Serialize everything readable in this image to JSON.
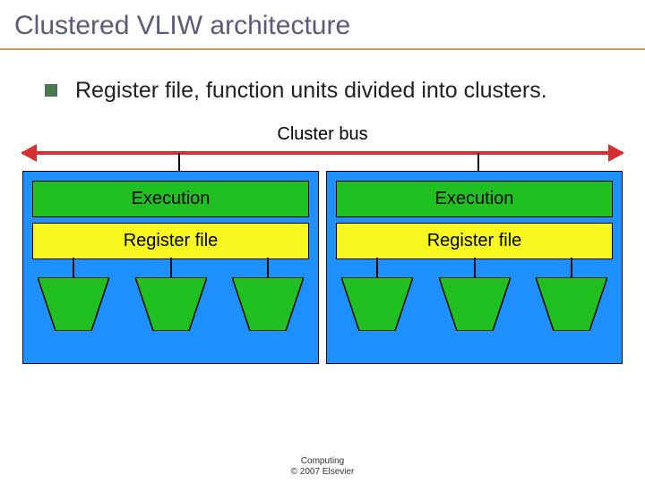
{
  "title": "Clustered VLIW architecture",
  "bullet": "Register file, function units divided into clusters.",
  "diagram": {
    "bus_label": "Cluster bus",
    "clusters": [
      {
        "execution_label": "Execution",
        "regfile_label": "Register file",
        "fu_count": 3
      },
      {
        "execution_label": "Execution",
        "regfile_label": "Register file",
        "fu_count": 3
      }
    ]
  },
  "footer": {
    "line1": "Computing",
    "line2": "© 2007 Elsevier"
  },
  "colors": {
    "cluster_bg": "#1e90ff",
    "exec_bg": "#20c020",
    "regfile_bg": "#f8f820",
    "bus": "#d83030"
  }
}
